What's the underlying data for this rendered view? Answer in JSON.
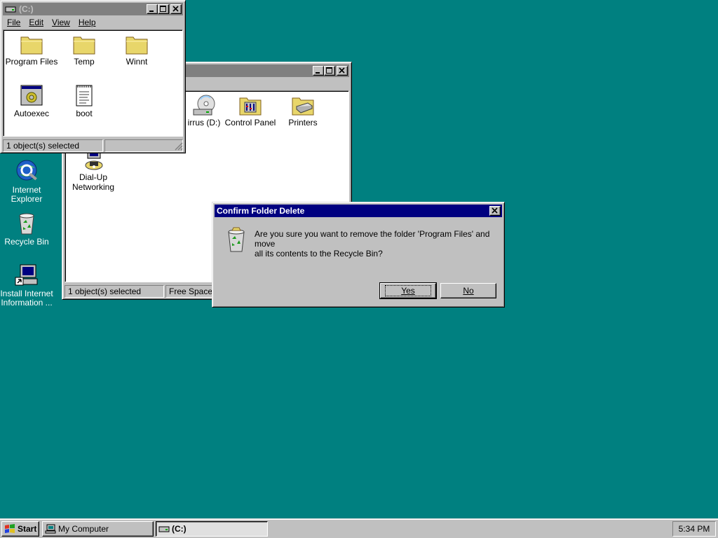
{
  "desktop": {
    "icons": [
      {
        "label_line1": "Internet",
        "label_line2": "Explorer"
      },
      {
        "label_line1": "Recycle Bin",
        "label_line2": ""
      },
      {
        "label_line1": "Install Internet",
        "label_line2": "Information ..."
      }
    ]
  },
  "my_computer_window": {
    "title": "",
    "items": [
      {
        "label": "irrus (D:)"
      },
      {
        "label": "Control Panel"
      },
      {
        "label": "Printers"
      },
      {
        "label_line1": "Dial-Up",
        "label_line2": "Networking"
      }
    ],
    "status": {
      "selected": "1 object(s) selected",
      "free_space": "Free Space:"
    }
  },
  "c_window": {
    "title": "(C:)",
    "menu": {
      "file": "File",
      "edit": "Edit",
      "view": "View",
      "help": "Help"
    },
    "items": [
      {
        "label": "Program Files"
      },
      {
        "label": "Temp"
      },
      {
        "label": "Winnt"
      },
      {
        "label": "Autoexec"
      },
      {
        "label": "boot"
      }
    ],
    "status": {
      "selected": "1 object(s) selected",
      "second": ""
    }
  },
  "dialog": {
    "title": "Confirm Folder Delete",
    "message_line1": "Are you sure you want to remove the folder 'Program Files' and move",
    "message_line2": "all its contents to the Recycle Bin?",
    "yes": "Yes",
    "no": "No"
  },
  "taskbar": {
    "start": "Start",
    "tasks": [
      {
        "label": "My Computer",
        "pressed": false
      },
      {
        "label": "(C:)",
        "pressed": true
      }
    ],
    "clock": "5:34 PM"
  },
  "colors": {
    "desktop": "#008080",
    "active_title": "#000080",
    "inactive_title": "#808080",
    "face": "#c0c0c0"
  }
}
